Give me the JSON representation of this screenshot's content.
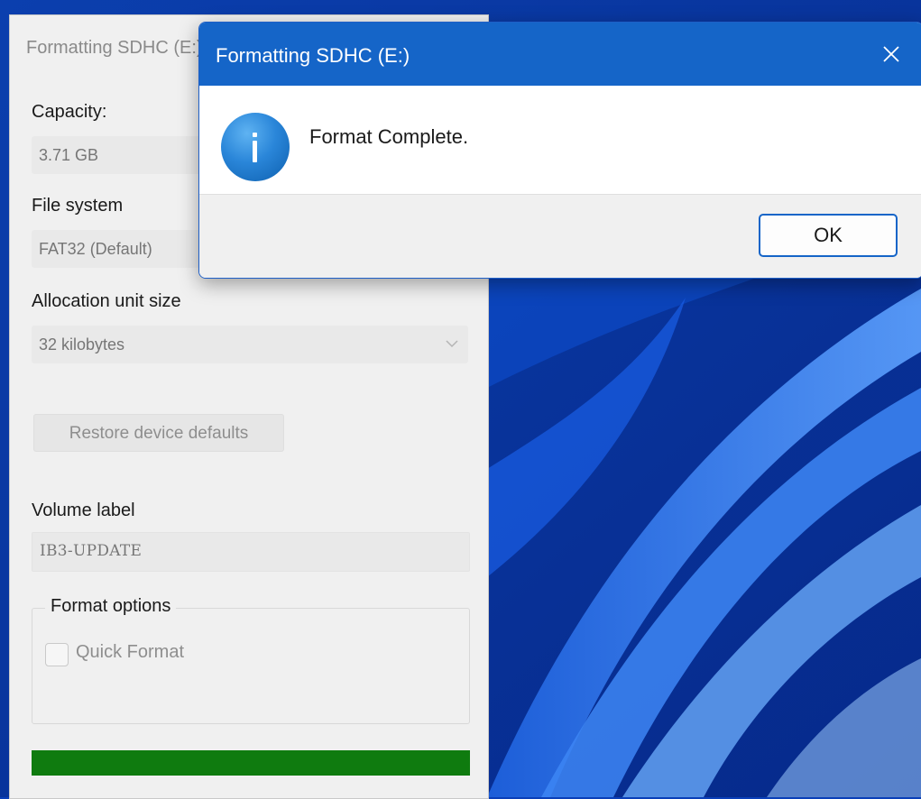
{
  "format_window": {
    "title": "Formatting SDHC (E:)",
    "capacity_label": "Capacity:",
    "capacity_value": "3.71 GB",
    "file_system_label": "File system",
    "file_system_value": "FAT32 (Default)",
    "allocation_label": "Allocation unit size",
    "allocation_value": "32 kilobytes",
    "restore_button": "Restore device defaults",
    "volume_label_label": "Volume label",
    "volume_label_value": "IB3-UPDATE",
    "format_options_label": "Format options",
    "quick_format_label": "Quick Format",
    "quick_format_checked": false,
    "progress_percent": 100,
    "progress_color": "#0f7b0f"
  },
  "dialog": {
    "title": "Formatting SDHC (E:)",
    "message": "Format Complete.",
    "ok_button": "OK",
    "icon": "info-icon",
    "accent_color": "#1565c8"
  }
}
